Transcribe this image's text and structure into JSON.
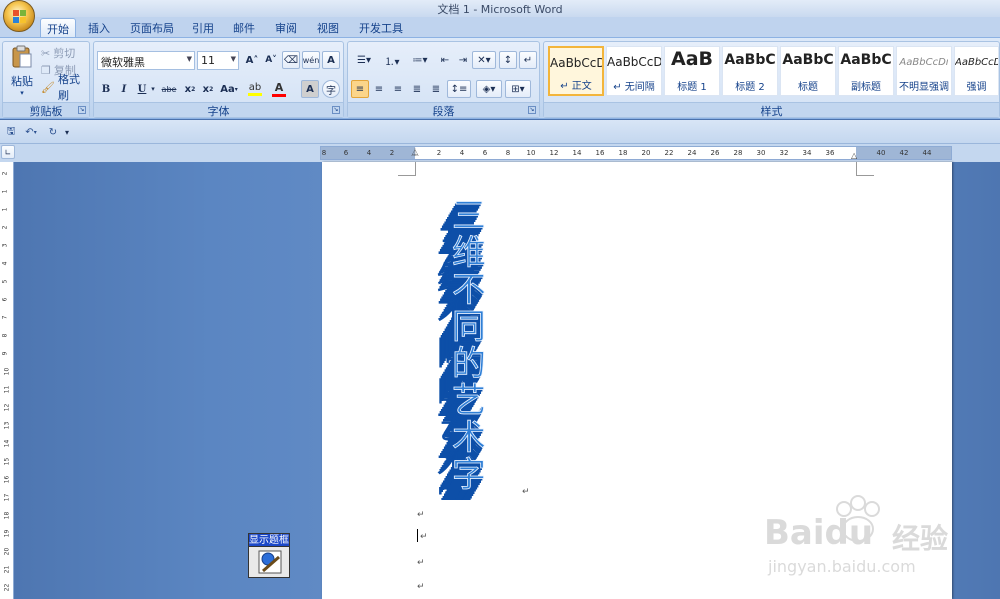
{
  "window": {
    "title": "文档 1 - Microsoft Word"
  },
  "tabs": [
    "开始",
    "插入",
    "页面布局",
    "引用",
    "邮件",
    "审阅",
    "视图",
    "开发工具"
  ],
  "clipboard": {
    "paste": "粘贴",
    "cut": "剪切",
    "copy": "复制",
    "format_painter": "格式刷",
    "label": "剪贴板"
  },
  "font": {
    "name": "微软雅黑",
    "size": "11",
    "label": "字体",
    "grow": "A",
    "shrink": "A",
    "bold": "B",
    "italic": "I",
    "underline": "U",
    "strike": "abe",
    "subscript": "x",
    "superscript": "x",
    "change_case": "Aa"
  },
  "paragraph": {
    "label": "段落"
  },
  "styles": {
    "label": "样式",
    "items": [
      {
        "sample": "AaBbCcD",
        "name": "正文"
      },
      {
        "sample": "AaBbCcD",
        "name": "无间隔"
      },
      {
        "sample": "AaB",
        "name": "标题 1"
      },
      {
        "sample": "AaBbC",
        "name": "标题 2"
      },
      {
        "sample": "AaBbC",
        "name": "标题"
      },
      {
        "sample": "AaBbC",
        "name": "副标题"
      },
      {
        "sample": "AaBbCcDı",
        "name": "不明显强调"
      },
      {
        "sample": "AaBbCcDı",
        "name": "强调"
      }
    ]
  },
  "ruler": {
    "h_numbers": [
      "8",
      "6",
      "4",
      "2",
      "2",
      "4",
      "6",
      "8",
      "10",
      "12",
      "14",
      "16",
      "18",
      "20",
      "22",
      "24",
      "26",
      "28",
      "30",
      "32",
      "34",
      "36",
      "40",
      "42",
      "44"
    ]
  },
  "vruler": {
    "numbers": [
      "2",
      "1",
      "1",
      "2",
      "3",
      "4",
      "5",
      "6",
      "7",
      "8",
      "9",
      "10",
      "11",
      "12",
      "13",
      "14",
      "15",
      "16",
      "17",
      "18",
      "19",
      "20",
      "21",
      "22"
    ]
  },
  "document": {
    "wordart_text": "三维不同的艺术字",
    "para_mark": "↵"
  },
  "floating_button": {
    "caption": "显示题框"
  },
  "watermark": {
    "brand": "Baidu",
    "brand_cn": "经验",
    "url": "jingyan.baidu.com"
  },
  "colors": {
    "highlight": "#ffff00",
    "font_color": "#ff0000",
    "wordart_front": "#2f7fd6",
    "wordart_side": "#0d4fa8"
  }
}
